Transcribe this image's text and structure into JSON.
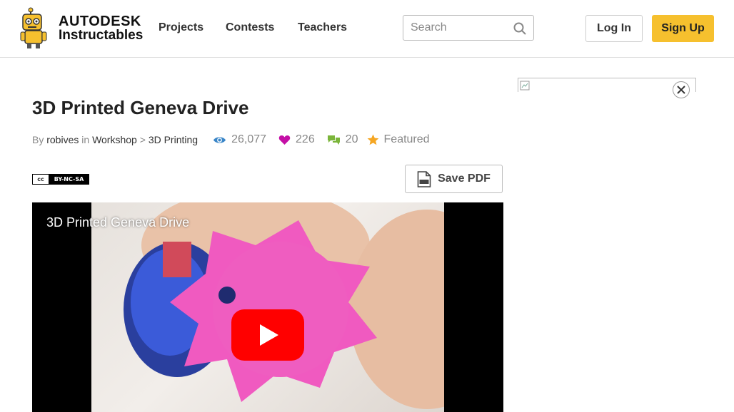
{
  "header": {
    "brand_top": "AUTODESK",
    "brand_bottom": "Instructables",
    "nav": [
      {
        "label": "Projects"
      },
      {
        "label": "Contests"
      },
      {
        "label": "Teachers"
      }
    ],
    "search": {
      "placeholder": "Search",
      "value": ""
    },
    "login_label": "Log In",
    "signup_label": "Sign Up"
  },
  "project": {
    "title": "3D Printed Geneva Drive",
    "by_label": "By",
    "author": "robives",
    "in_label": "in",
    "category": "Workshop",
    "separator": ">",
    "channel": "3D Printing",
    "views": "26,077",
    "favorites": "226",
    "comments": "20",
    "featured": "Featured",
    "license": {
      "left": "cc",
      "right": "BY-NC-SA"
    },
    "save_pdf_label": "Save PDF"
  },
  "video": {
    "title": "3D Printed Geneva Drive",
    "play_icon": "youtube-play-icon"
  },
  "colors": {
    "accent_yellow": "#f6c02e",
    "views_blue": "#3a86c8",
    "favorite_purple": "#c40fa6",
    "comments_green": "#7bb53a",
    "featured_orange": "#f5a623",
    "youtube_red": "#ff0000"
  }
}
